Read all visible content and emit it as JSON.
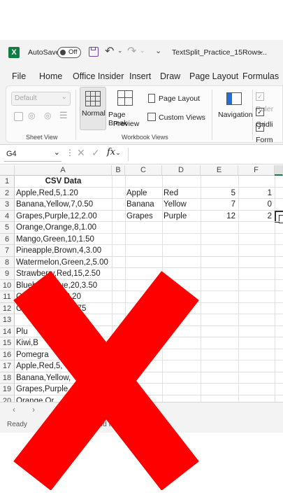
{
  "titlebar": {
    "app_icon": "X",
    "autosave_label": "AutoSave",
    "autosave_state": "Off",
    "filename": "TextSplit_Practice_15Rows..."
  },
  "menu": [
    "File",
    "Home",
    "Office Insider",
    "Insert",
    "Draw",
    "Page Layout",
    "Formulas"
  ],
  "ribbon": {
    "style_default": "Default",
    "normal": "Normal",
    "page_break_1": "Page Break",
    "page_break_2": "Preview",
    "page_layout": "Page Layout",
    "custom_views": "Custom Views",
    "navigation": "Navigation",
    "ruler": "Ruler",
    "gridlines": "Gridli",
    "formula": "Form",
    "group_sheet_view": "Sheet View",
    "group_workbook_views": "Workbook Views"
  },
  "formula_bar": {
    "name_box": "G4",
    "fx": "fx"
  },
  "columns": [
    "A",
    "B",
    "C",
    "D",
    "E",
    "F"
  ],
  "rows": [
    "1",
    "2",
    "3",
    "4",
    "5",
    "6",
    "7",
    "8",
    "9",
    "10",
    "11",
    "12",
    "13",
    "14",
    "15",
    "16",
    "17",
    "18",
    "19",
    "20"
  ],
  "header_cell": "CSV Data",
  "col_a": [
    "Apple,Red,5,1.20",
    "Banana,Yellow,7,0.50",
    "Grapes,Purple,12,2.00",
    "Orange,Orange,8,1.00",
    "Mango,Green,10,1.50",
    "Pineapple,Brown,4,3.00",
    "Watermelon,Green,2,5.00",
    "Strawberry,Red,15,2.50",
    "Blueberry,Blue,20,3.50",
    "C",
    "C",
    "",
    "Plu",
    "Kiwi,B",
    "Pomegra",
    "Apple,Red,5,",
    "Banana,Yellow,",
    "Grapes,Purple",
    "Orange,Or"
  ],
  "col_a_fragment_11": "8,2.20",
  "col_a_fragment_12": "1.75",
  "split": {
    "c": [
      "Apple",
      "Banana",
      "Grapes"
    ],
    "d": [
      "Red",
      "Yellow",
      "Purple"
    ],
    "e": [
      "5",
      "7",
      "12"
    ],
    "f": [
      "1",
      "0",
      "2"
    ]
  },
  "status": {
    "ready": "Ready",
    "accessibility": "ty: Good to"
  },
  "overlay": {
    "mark": "red-x",
    "color": "#ff0000"
  }
}
